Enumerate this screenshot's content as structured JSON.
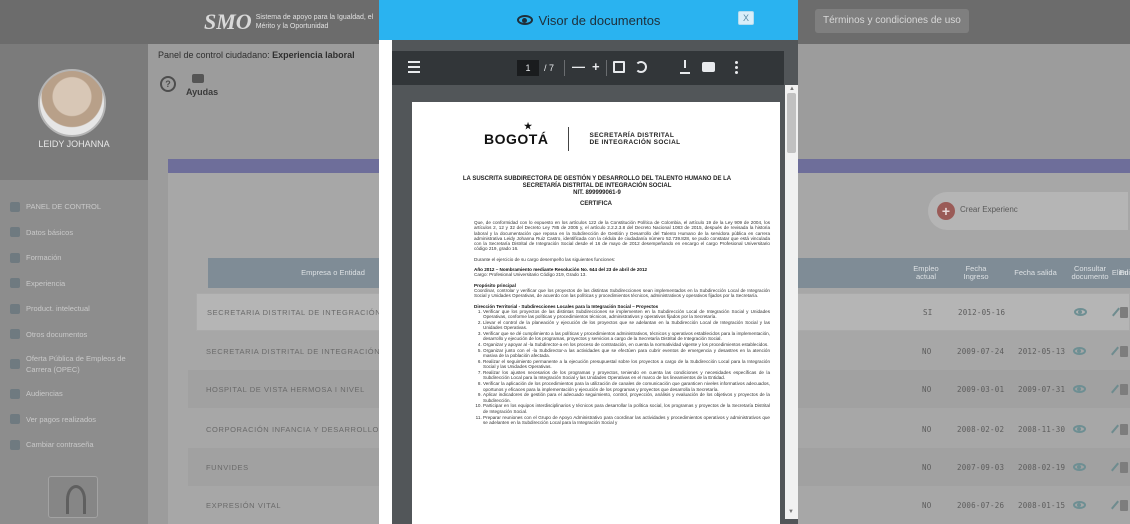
{
  "header": {
    "logo_mark": "SMO",
    "logo_text": "Sistema de apoyo para la Igualdad, el Mérito y la Oportunidad",
    "terms_link": "Términos y condiciones de uso"
  },
  "sidebar": {
    "profile_name": "LEIDY JOHANNA",
    "items": [
      {
        "label": "PANEL DE CONTROL",
        "icon": "dashboard-icon"
      },
      {
        "label": "Datos básicos",
        "icon": "people-icon"
      },
      {
        "label": "Formación",
        "icon": "graduation-icon"
      },
      {
        "label": "Experiencia",
        "icon": "briefcase-icon"
      },
      {
        "label": "Product. intelectual",
        "icon": "book-icon"
      },
      {
        "label": "Otros documentos",
        "icon": "document-icon"
      },
      {
        "label": "Oferta Pública de Empleos de Carrera (OPEC)",
        "icon": "globe-icon"
      },
      {
        "label": "Audiencias",
        "icon": "audience-icon"
      },
      {
        "label": "Ver pagos realizados",
        "icon": "dollar-icon"
      },
      {
        "label": "Cambiar contraseña",
        "icon": "lock-icon"
      }
    ]
  },
  "main": {
    "breadcrumb_prefix": "Panel de control ciudadano: ",
    "breadcrumb_page": "Experiencia laboral",
    "help_label": "Ayudas",
    "create_button": "Crear Experienc",
    "columns": {
      "entity": "Empresa o Entidad",
      "current": "Empleo actual",
      "start": "Fecha Ingreso",
      "end": "Fecha salida",
      "doc": "Consultar documento",
      "edit": "Editar",
      "delete": "Elimi"
    },
    "rows": [
      {
        "entity": "SECRETARIA DISTRITAL DE INTEGRACIÓN SOCIAL",
        "current": "SI",
        "start": "2012-05-16",
        "end": ""
      },
      {
        "entity": "SECRETARIA DISTRITAL DE INTEGRACIÓN SOCIAL",
        "current": "NO",
        "start": "2009-07-24",
        "end": "2012-05-13"
      },
      {
        "entity": "HOSPITAL DE VISTA HERMOSA I NIVEL",
        "current": "NO",
        "start": "2009-03-01",
        "end": "2009-07-31"
      },
      {
        "entity": "CORPORACIÓN INFANCIA Y DESARROLLO",
        "current": "NO",
        "start": "2008-02-02",
        "end": "2008-11-30"
      },
      {
        "entity": "FUNVIDES",
        "current": "NO",
        "start": "2007-09-03",
        "end": "2008-02-19"
      },
      {
        "entity": "EXPRESIÓN VITAL",
        "current": "NO",
        "start": "2006-07-26",
        "end": "2008-01-15"
      }
    ]
  },
  "modal": {
    "title": "Visor de documentos",
    "close": "X",
    "viewer": {
      "page_current": "1",
      "page_total": "/ 7",
      "zoom_out": "—",
      "zoom_in": "+"
    },
    "document": {
      "logo": "BOGOTÁ",
      "secretaria_line1": "SECRETARÍA DISTRITAL",
      "secretaria_line2": "DE INTEGRACIÓN SOCIAL",
      "heading": "LA SUSCRITA SUBDIRECTORA DE GESTIÓN Y DESARROLLO DEL TALENTO HUMANO DE LA SECRETARÍA DISTRITAL DE INTEGRACIÓN SOCIAL",
      "nit": "NIT. 899999061-9",
      "certifica": "CERTIFICA",
      "intro": "Que, de conformidad con lo expuesto en los artículos 122 de la Constitución Política de Colombia, el artículo 19 de la Ley 909 de 2004, los artículos 2, 12 y 32 del Decreto Ley 785 de 2005 y, el artículo 2.2.2.3.8 del Decreto Nacional 1083 de 2015, después de revisada la historia laboral y la documentación que reposa en la Subdirección de Gestión y Desarrollo del Talento Humano de la servidora pública en carrera administrativa Leidy Johanna Ruiz Castro, identificada con la cédula de ciudadanía número 52.739.828, se pudo constatar que está vinculada con la Secretaría Distrital de Integración Social desde el 16 de mayo de 2012 desempeñando en encargo el cargo Profesional Universitario código 219, grado 16.",
      "functions_intro": "Durante el ejercicio de su cargo desempeño las siguientes funciones:",
      "year_line": "Año 2012 – Nombramiento mediante Resolución No. 644 del 23 de abril de 2012",
      "cargo_line": "Cargo: Profesional Universitario Código 219, Grado 13.",
      "purpose_title": "Propósito principal",
      "purpose_text": "Coordinar, controlar y verificar que los proyectos de las distintas Subdirecciones sean implementados en la Subdirección Local de Integración Social y Unidades Operativas, de acuerdo con las políticas y procedimientos técnicos, administrativos y operativos fijados por la Secretaría.",
      "direction_title": "Dirección Territorial - Subdirecciones Locales para la Integración Social – Proyectos",
      "items": [
        "Verificar que los proyectos de las distintas Subdirecciones se implementen en la Subdirección Local de Integración Social y Unidades Operativas, conforme las políticas y procedimientos técnicos, administrativos y operativos fijados por la Secretaría.",
        "Llevar el control de la planeación y ejecución de los proyectos que se adelantan en la Subdirección Local de Integración Social y las Unidades Operativas.",
        "Verificar que se dé cumplimiento a las políticas y procedimientos administrativos, técnicos y operativos establecidos para la implementación, desarrollo y ejecución de los programas, proyectos y servicios a cargo de la Secretaría Distrital de Integración Social.",
        "Organizar y apoyar al -la Subdirector-a en los proceso de contratación, en cuenta la normatividad vigente y los procedimientos establecidos.",
        "Organizar junto con el -la Subdirector-a las actividades que se efectúen para cubrir eventos de emergencia y desastres en la atención masiva de la población afectada.",
        "Realizar el seguimiento permanente a la ejecución presupuestal sobre los proyectos a cargo de la Subdirección Local para la Integración Social y las Unidades Operativas.",
        "Realizar los ajustes necesarios de los programas y proyectos, teniendo en cuenta las condiciones y necesidades específicas de la Subdirección Local para la Integración Social y las Unidades Operativas en el marco de los lineamientos de la Entidad.",
        "Verificar la aplicación de los procedimientos para la utilización de canales de comunicación que garanticen niveles informativos adecuados, oportunos y eficaces para la implementación y ejecución de los programas y proyectos que desarrolla la Secretaría.",
        "Aplicar indicadores de gestión para el adecuado seguimiento, control, proyección, análisis y evaluación de los objetivos y proyectos de la Subdirección.",
        "Participar en los equipos interdisciplinarios y técnicos para desarrollar la política social, los programas y proyectos de la Secretaría Distrital de Integración Social.",
        "Preparar reuniones con el Grupo de Apoyo Administrativo para coordinar las actividades y procedimientos operativos y administrativos que se adelanten en la Subdirección Local para la Integración Social y"
      ]
    }
  }
}
